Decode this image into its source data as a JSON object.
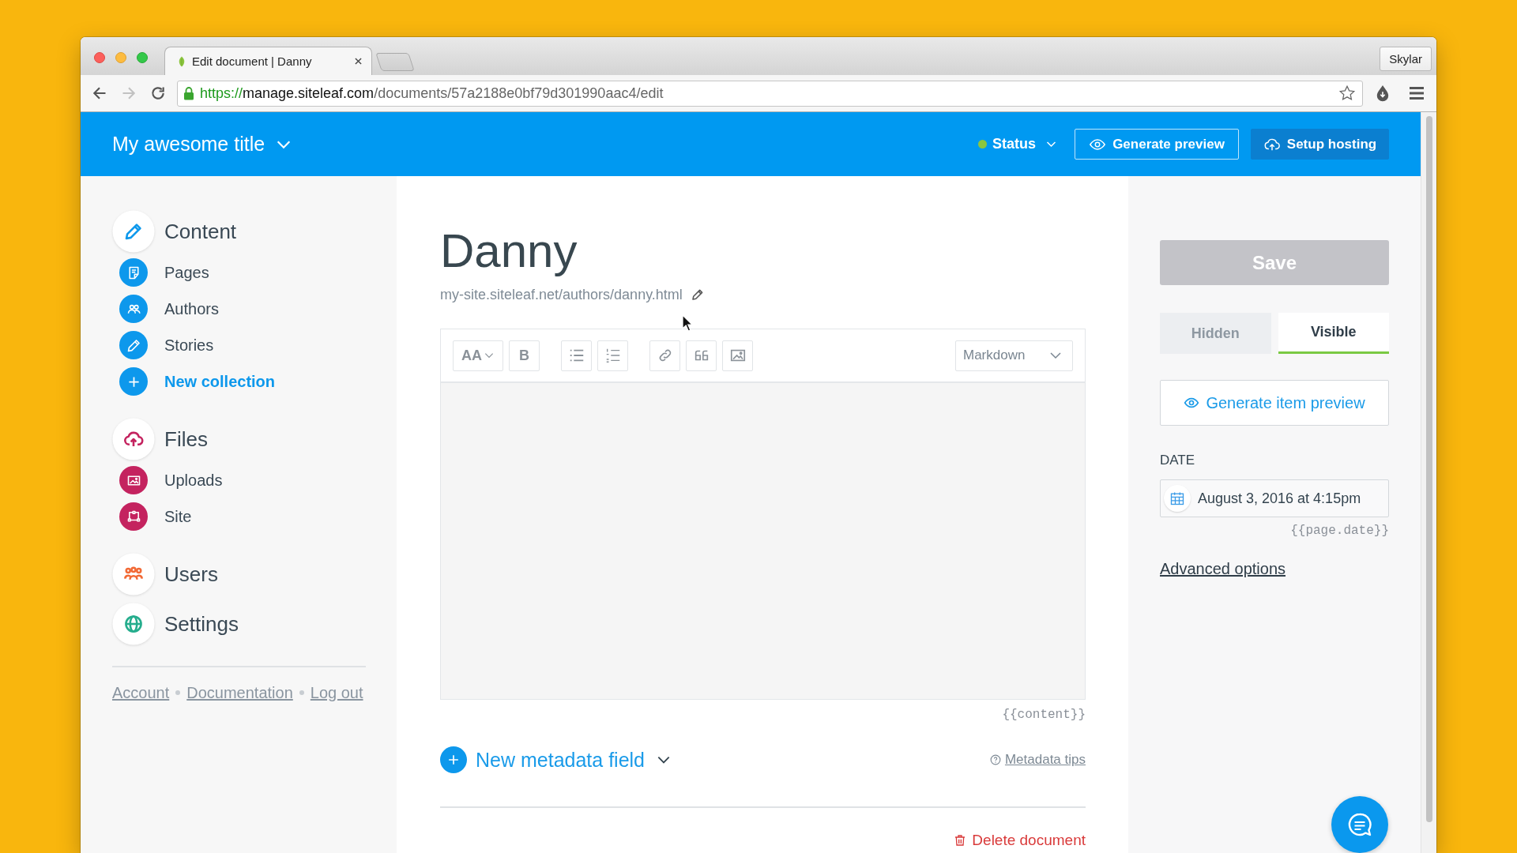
{
  "browser": {
    "tabs": [
      {
        "title": "Edit document | Danny",
        "selected": true
      }
    ],
    "profile_button": "Skylar",
    "nav_buttons": [
      {
        "kind": "back",
        "disabled": false
      },
      {
        "kind": "forward",
        "disabled": true
      },
      {
        "kind": "reload",
        "disabled": false
      }
    ],
    "address_bar": {
      "secure": true,
      "scheme": "https://",
      "host": "manage.siteleaf.com",
      "path": "/documents/57a2188e0bf79d301990aac4/edit"
    }
  },
  "header": {
    "site_title": "My awesome title",
    "status": {
      "label": "Status",
      "color": "#8cc63f"
    },
    "buttons": [
      {
        "kind": "preview",
        "label": "Generate preview"
      },
      {
        "kind": "hosting",
        "label": "Setup hosting"
      }
    ]
  },
  "sidebar": {
    "sections": [
      {
        "label": "Content",
        "kind": "content",
        "color": "#0d98ec",
        "items": [
          {
            "label": "Pages",
            "kind": "pages"
          },
          {
            "label": "Authors",
            "kind": "authors"
          },
          {
            "label": "Stories",
            "kind": "stories"
          },
          {
            "label": "New collection",
            "kind": "add"
          }
        ]
      },
      {
        "label": "Files",
        "kind": "files",
        "color": "#c4235f",
        "items": [
          {
            "label": "Uploads",
            "kind": "uploads"
          },
          {
            "label": "Site",
            "kind": "site"
          }
        ]
      },
      {
        "label": "Users",
        "kind": "users",
        "color": "#f26a36"
      },
      {
        "label": "Settings",
        "kind": "settings",
        "color": "#25ad8d"
      }
    ],
    "footer_links": [
      "Account",
      "Documentation",
      "Log out"
    ]
  },
  "document": {
    "title": "Danny",
    "permalink": "my-site.siteleaf.net/authors/danny.html",
    "toolbar": [
      {
        "kind": "heading",
        "label": "AA"
      },
      {
        "kind": "bold",
        "label": "B"
      },
      {
        "kind": "bullet_list"
      },
      {
        "kind": "numbered_list"
      },
      {
        "kind": "link"
      },
      {
        "kind": "quote"
      },
      {
        "kind": "image"
      }
    ],
    "format": "Markdown",
    "content_variable": "{{content}}",
    "add_metadata": "New metadata field",
    "metadata_tips": "Metadata tips",
    "delete": "Delete document"
  },
  "inspector": {
    "save": {
      "label": "Save",
      "disabled": true
    },
    "visibility": [
      {
        "label": "Hidden",
        "selected": false
      },
      {
        "label": "Visible",
        "selected": true
      }
    ],
    "preview_button": "Generate item preview",
    "date": {
      "label": "DATE",
      "value": "August 3, 2016 at 4:15pm",
      "variable": "{{page.date}}"
    },
    "advanced_link": "Advanced options"
  }
}
